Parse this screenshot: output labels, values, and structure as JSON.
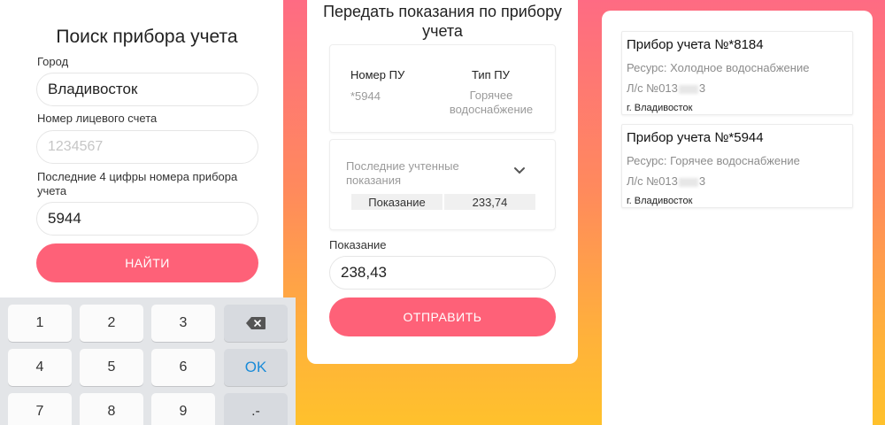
{
  "search": {
    "title": "Поиск прибора учета",
    "city_label": "Город",
    "city_value": "Владивосток",
    "account_label": "Номер лицевого счета",
    "account_placeholder": "1234567",
    "digits_label": "Последние 4 цифры номера прибора учета",
    "digits_value": "5944",
    "find_button": "НАЙТИ"
  },
  "keypad": {
    "keys": [
      "1",
      "2",
      "3",
      "4",
      "5",
      "6",
      "7",
      "8",
      "9"
    ],
    "ok_label": "OK",
    "punct_label": ".-",
    "backspace_icon": "backspace-icon"
  },
  "submit": {
    "title": "Передать показания по прибору учета",
    "meter_number_header": "Номер ПУ",
    "meter_number_value": "*5944",
    "meter_type_header": "Тип ПУ",
    "meter_type_value": "Горячее водоснабжение",
    "last_readings_label": "Последние учтенные показания",
    "reading_col_label": "Показание",
    "reading_col_value": "233,74",
    "reading_label": "Показание",
    "reading_value": "238,43",
    "send_button": "ОТПРАВИТЬ"
  },
  "devices": {
    "items": [
      {
        "name": "Прибор учета №*8184",
        "resource": "Ресурс: Холодное водоснабжение",
        "account_prefix": "Л/с №013",
        "account_suffix": "3",
        "city": "г. Владивосток"
      },
      {
        "name": "Прибор учета №*5944",
        "resource": "Ресурс: Горячее водоснабжение",
        "account_prefix": "Л/с №013",
        "account_suffix": "3",
        "city": "г. Владивосток"
      }
    ]
  },
  "colors": {
    "accent": "#fe6178",
    "ok_key": "#1a8bd8",
    "gradient_top": "#fe6b83",
    "gradient_bottom": "#ffc12c"
  }
}
